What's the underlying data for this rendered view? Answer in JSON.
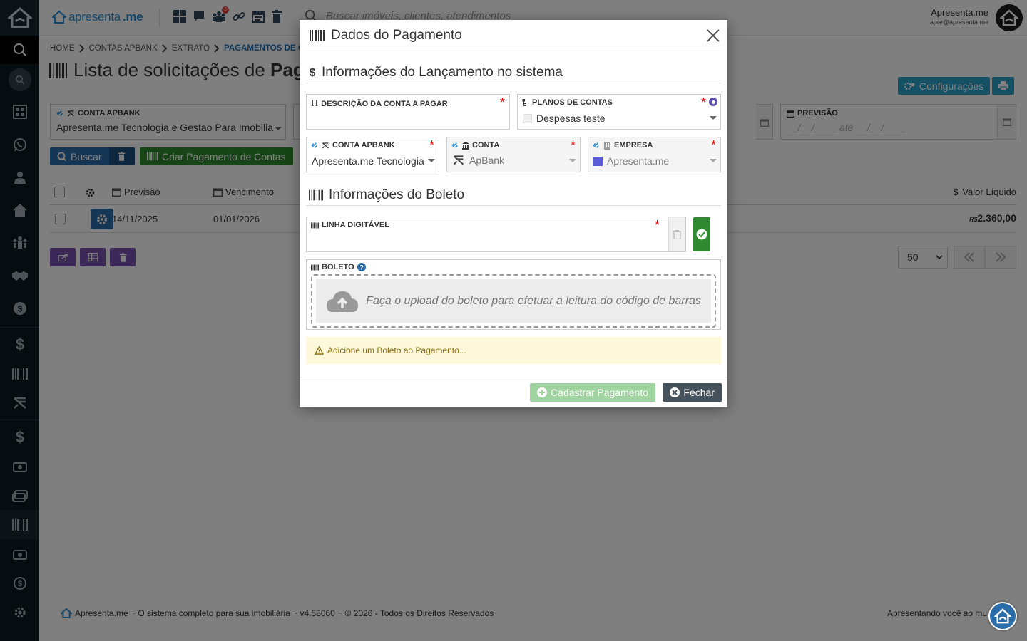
{
  "app": {
    "brand": "apresenta",
    "brand_suffix": ".me",
    "search_placeholder": "Buscar imóveis, clientes, atendimentos",
    "notification_count": "3",
    "user_name": "Apresenta.me",
    "user_email": "apre@apresenta.me",
    "accent_color": "#2a6da8"
  },
  "breadcrumb": [
    "HOME",
    "CONTAS APBANK",
    "EXTRATO",
    "PAGAMENTOS DE C"
  ],
  "page": {
    "title_regular": "Lista de solicitações de ",
    "title_bold": "Pag",
    "config_label": "Configurações",
    "filters": {
      "conta_apbank_label": "CONTA APBANK",
      "conta_apbank_value": "Apresenta.me Tecnologia e Gestao Para Imobiliar",
      "previsao_label": "PREVISÃO",
      "previsao_placeholder": "__/__/____ até __/__/____"
    },
    "buscar_label": "Buscar",
    "criar_label": "Criar Pagamento de Contas",
    "table": {
      "headers": {
        "previsao": "Previsão",
        "vencimento": "Vencimento",
        "valor": "Valor Líquido"
      },
      "rows": [
        {
          "previsao": "14/11/2025",
          "vencimento": "01/01/2026",
          "currency": "R$",
          "valor": "2.360,00"
        }
      ]
    },
    "page_size": "50",
    "footer": "Apresenta.me ~ O sistema completo para sua imobiliária ~ v4.58060 ~ © 2026 - Todos os Direitos Reservados",
    "footer_right": "Apresentando você ao mu"
  },
  "modal": {
    "title": "Dados do Pagamento",
    "section1": "Informações do Lançamento no sistema",
    "descricao_label": "DESCRIÇÃO DA CONTA A PAGAR",
    "descricao_value": "",
    "planos_label": "PLANOS DE CONTAS",
    "planos_value": "Despesas teste",
    "conta_apbank_label": "CONTA APBANK",
    "conta_apbank_value": "Apresenta.me Tecnologia",
    "conta_label": "CONTA",
    "conta_value": "ApBank",
    "empresa_label": "EMPRESA",
    "empresa_value": "Apresenta.me",
    "empresa_color": "#5b5bd6",
    "section2": "Informações do Boleto",
    "linha_label": "LINHA DIGITÁVEL",
    "linha_value": "",
    "boleto_label": "BOLETO",
    "upload_text": "Faça o upload do boleto para efetuar a leitura do código de barras",
    "alert": "Adicione um Boleto ao Pagamento...",
    "cadastrar_label": "Cadastrar Pagamento",
    "fechar_label": "Fechar"
  }
}
